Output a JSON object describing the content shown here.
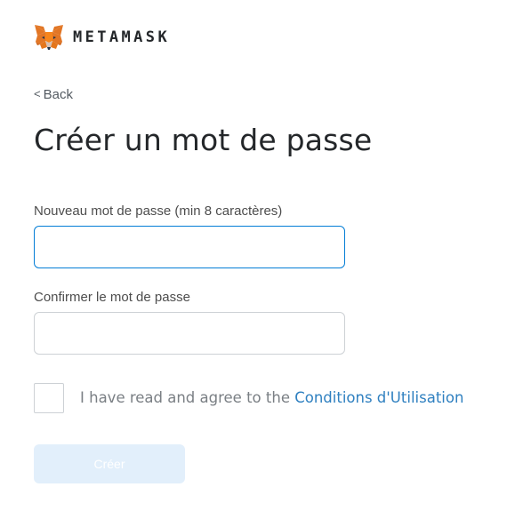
{
  "header": {
    "brand": "METAMASK",
    "logo_icon": "metamask-fox-icon"
  },
  "nav": {
    "back_icon": "chevron-left-icon",
    "back_glyph": "<",
    "back_label": "Back"
  },
  "page": {
    "title": "Créer un mot de passe"
  },
  "form": {
    "new_password": {
      "label": "Nouveau mot de passe (min 8 caractères)",
      "value": "",
      "placeholder": ""
    },
    "confirm_password": {
      "label": "Confirmer le mot de passe",
      "value": "",
      "placeholder": ""
    },
    "terms": {
      "checked": false,
      "text": "I have read and agree to the ",
      "link_text": "Conditions d'Utilisation"
    },
    "submit_label": "Créer",
    "submit_enabled": false
  },
  "colors": {
    "accent": "#037dd6",
    "link": "#2f80c0",
    "button_disabled_bg": "#e2effb",
    "title": "#24272a"
  }
}
